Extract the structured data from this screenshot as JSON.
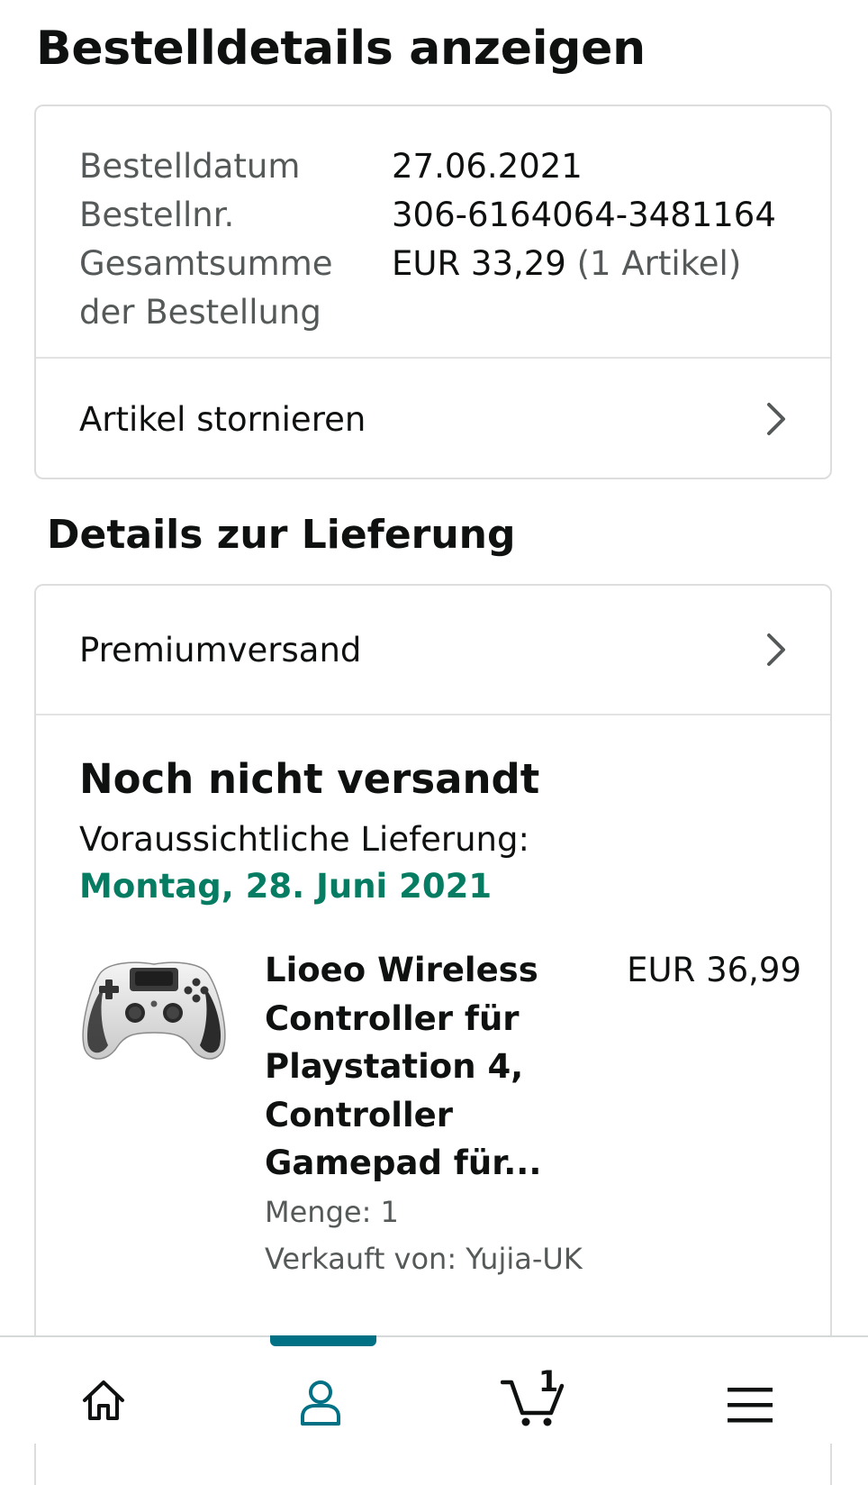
{
  "page_title": "Bestelldetails anzeigen",
  "order_summary": {
    "date_label": "Bestelldatum",
    "date_value": "27.06.2021",
    "number_label": "Bestellnr.",
    "number_value": "306-6164064-3481164",
    "total_label_line1": "Gesamtsumme",
    "total_label_line2": "der Bestellung",
    "total_value": "EUR 33,29",
    "total_items": "(1 Artikel)"
  },
  "cancel_label": "Artikel stornieren",
  "delivery_section_title": "Details zur Lieferung",
  "shipping_method": "Premiumversand",
  "shipment": {
    "status": "Noch nicht versandt",
    "estimated_label": "Voraussichtliche Lieferung:",
    "estimated_date": "Montag, 28. Juni 2021",
    "status_color": "#067d62"
  },
  "product": {
    "title_lines": [
      "Lioeo Wireless",
      "Controller für",
      "Playstation 4,",
      "Controller",
      "Gamepad für..."
    ],
    "price": "EUR 36,99",
    "quantity": "Menge: 1",
    "seller": "Verkauft von: Yujia-UK",
    "image_icon": "gamepad-controller-image"
  },
  "bottom_nav": {
    "items": [
      "home-icon",
      "account-icon",
      "cart-icon",
      "menu-icon"
    ],
    "active": "account-icon",
    "cart_count": "1",
    "accent_color": "#007185"
  }
}
